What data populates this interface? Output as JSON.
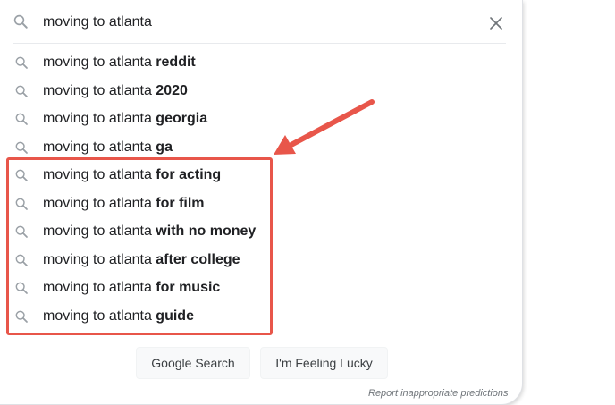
{
  "search": {
    "query": "moving to atlanta",
    "icon": "search-icon",
    "clear_icon": "close-icon"
  },
  "suggestions": [
    {
      "prefix": "moving to atlanta ",
      "completion": "reddit"
    },
    {
      "prefix": "moving to atlanta ",
      "completion": "2020"
    },
    {
      "prefix": "moving to atlanta ",
      "completion": "georgia"
    },
    {
      "prefix": "moving to atlanta ",
      "completion": "ga"
    },
    {
      "prefix": "moving to atlanta ",
      "completion": "for acting"
    },
    {
      "prefix": "moving to atlanta ",
      "completion": "for film"
    },
    {
      "prefix": "moving to atlanta ",
      "completion": "with no money"
    },
    {
      "prefix": "moving to atlanta ",
      "completion": "after college"
    },
    {
      "prefix": "moving to atlanta ",
      "completion": "for music"
    },
    {
      "prefix": "moving to atlanta ",
      "completion": "guide"
    }
  ],
  "buttons": {
    "search_label": "Google Search",
    "lucky_label": "I'm Feeling Lucky"
  },
  "report_link": "Report inappropriate predictions",
  "colors": {
    "annotation": "#e8564a",
    "icon": "#9aa0a6",
    "text": "#202124",
    "button_bg": "#f8f9fa"
  }
}
